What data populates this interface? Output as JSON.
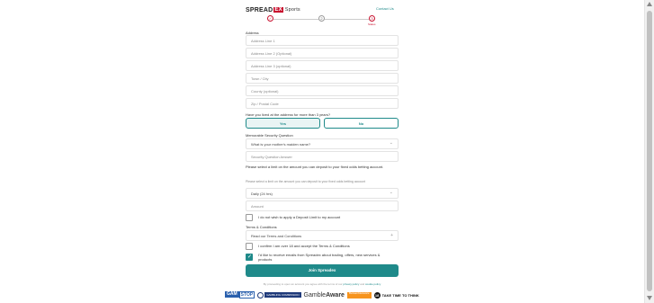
{
  "brand": {
    "spread": "SPREAD",
    "ex": "EX",
    "sports": "Sports"
  },
  "header": {
    "contact_link": "Contact Us"
  },
  "steps": {
    "step1": "✓",
    "step2": "2",
    "step3": "3",
    "step3_label": "Status"
  },
  "address": {
    "label": "Address",
    "line1_placeholder": "Address Line 1",
    "line2_placeholder": "Address Line 2 (Optional)",
    "line3_placeholder": "Address Line 3 (optional)",
    "town_placeholder": "Town / City",
    "county_placeholder": "County (optional)",
    "zip_placeholder": "Zip / Postal Code"
  },
  "residency": {
    "question": "Have you lived at the address for more than 3 years?",
    "yes": "Yes",
    "no": "No"
  },
  "security": {
    "label": "Memorable Security Question",
    "question_selected": "What is your mother's maiden name?",
    "answer_placeholder": "Security Question Answer"
  },
  "deposit": {
    "question": "Please select a limit on the amount you can deposit to your fixed odds betting account.",
    "note": "Please select a limit on the amount you can deposit to your fixed odds betting account",
    "period_selected": "Daily (24 hrs)",
    "amount_placeholder": "Amount",
    "no_limit_label": "I do not wish to apply a Deposit Limit to my account"
  },
  "terms": {
    "label": "Terms & Conditions",
    "read_label": "Read our Terms and Conditions",
    "confirm_label": "I confirm I am over 18 and accept the Terms & Conditions",
    "confirm_checked": false,
    "marketing_label": "I'd like to receive emails from Spreadex about trading, offers, new services & products",
    "marketing_checked": true
  },
  "submit": {
    "join_label": "Join Spreadex"
  },
  "fine_print": {
    "text": "By proceeding to open an account you agree with the terms of our",
    "link1": "privacy policy",
    "and": "and",
    "link2": "cookie policy"
  },
  "footer": {
    "gamstop_a": "GAM",
    "gamstop_b": "STOP",
    "gc_text": "GAMBLING COMMISSION",
    "aware_a": "Gamble",
    "aware_b": "Aware",
    "be_text": "BeGambleAware",
    "ttt_text": "TAKE TIME TO THINK",
    "ttt_badge": "18"
  },
  "colors": {
    "accent": "#1f8a8a",
    "brand_red": "#c8102e"
  }
}
